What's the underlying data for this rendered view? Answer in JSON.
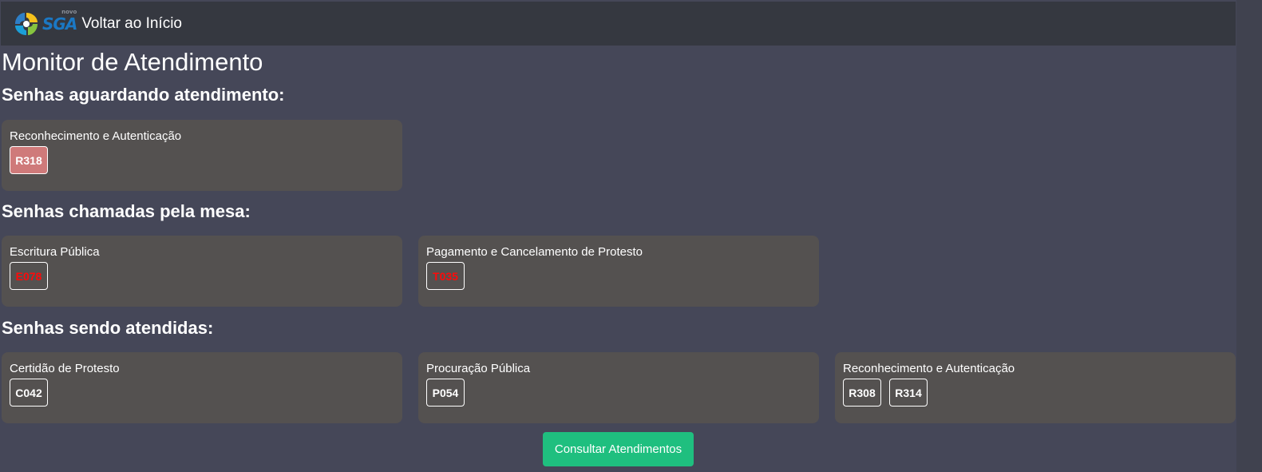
{
  "header": {
    "logo_text": "SGA",
    "logo_superscript": "novo",
    "home_link": "Voltar ao Início"
  },
  "page_title": "Monitor de Atendimento",
  "sections": {
    "waiting": {
      "title": "Senhas aguardando atendimento:",
      "cards": [
        {
          "service": "Reconhecimento e Autenticação",
          "tickets": [
            "R318"
          ]
        }
      ]
    },
    "called": {
      "title": "Senhas chamadas pela mesa:",
      "cards": [
        {
          "service": "Escritura Pública",
          "tickets": [
            "E078"
          ]
        },
        {
          "service": "Pagamento e Cancelamento de Protesto",
          "tickets": [
            "T035"
          ]
        }
      ]
    },
    "serving": {
      "title": "Senhas sendo atendidas:",
      "cards": [
        {
          "service": "Certidão de Protesto",
          "tickets": [
            "C042"
          ]
        },
        {
          "service": "Procuração Pública",
          "tickets": [
            "P054"
          ]
        },
        {
          "service": "Reconhecimento e Autenticação",
          "tickets": [
            "R308",
            "R314"
          ]
        }
      ]
    }
  },
  "consult_button": "Consultar Atendimentos",
  "colors": {
    "background": "#454758",
    "header": "#353840",
    "card": "#545150",
    "waiting_ticket": "#cf7a7a",
    "called_ticket_text": "#ff0a0a",
    "consult_button": "#1fbf7f",
    "logo_blue": "#1b78c4"
  }
}
